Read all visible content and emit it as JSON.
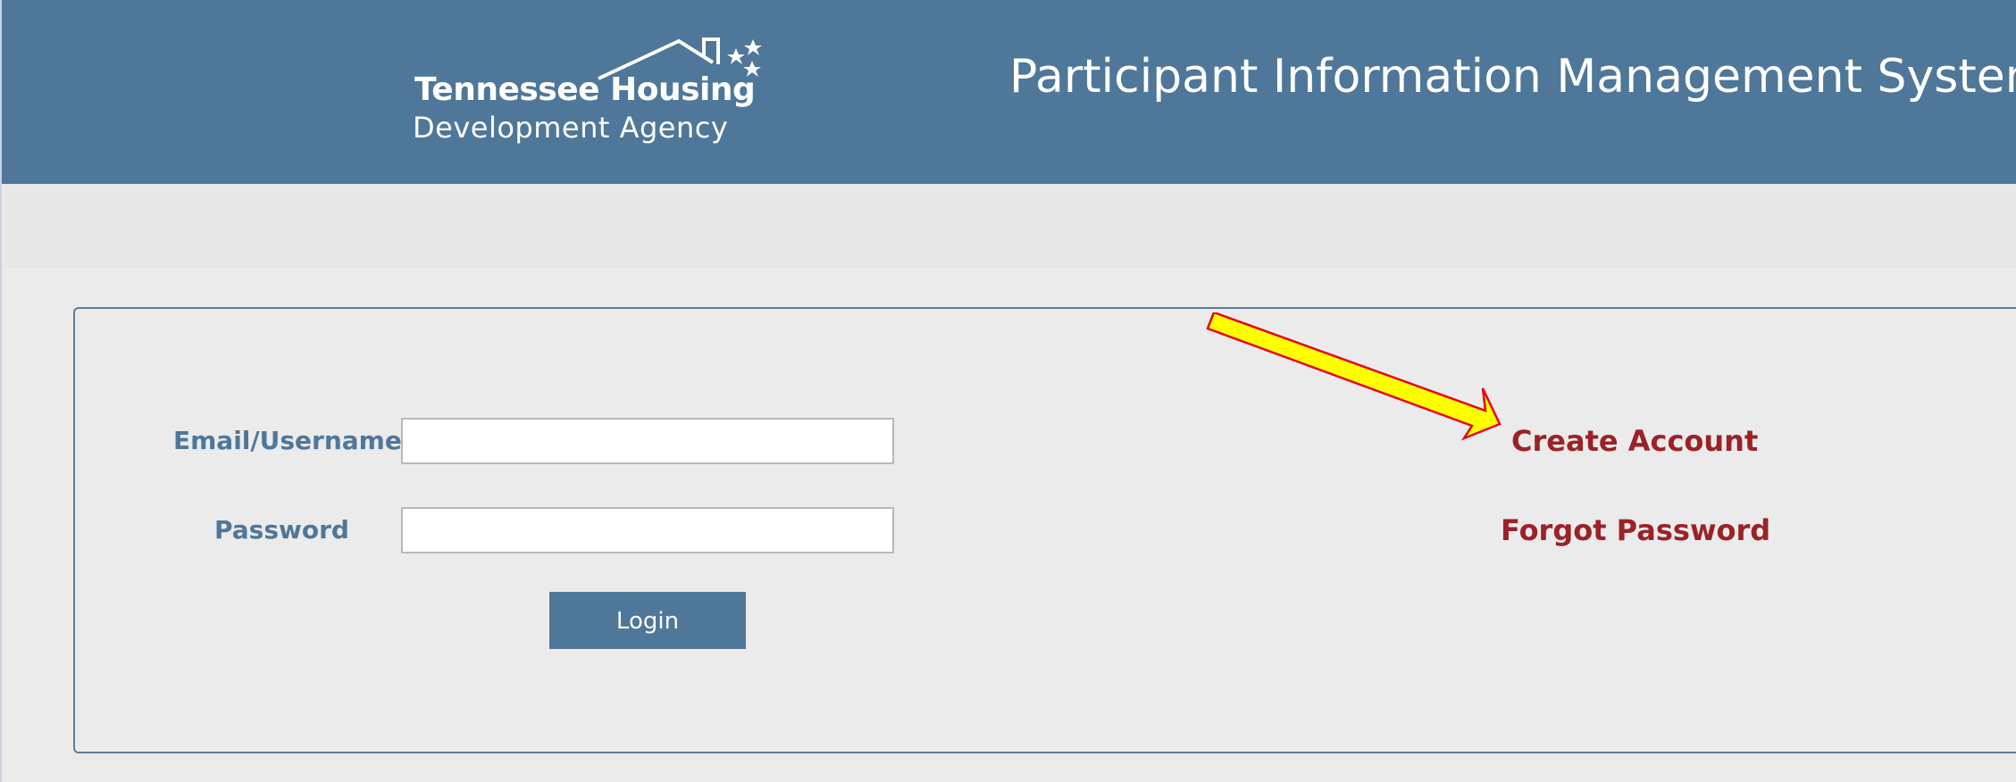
{
  "header": {
    "logo": {
      "line1": "Tennessee Housing",
      "line2": "Development Agency",
      "icon_name": "house-stars-logo-icon"
    },
    "app_title": "Participant Information Management System",
    "background_color": "#4f7799"
  },
  "login_form": {
    "email_label": "Email/Username",
    "email_value": "",
    "email_placeholder": "",
    "password_label": "Password",
    "password_value": "",
    "password_placeholder": "",
    "login_button_label": "Login"
  },
  "links": {
    "create_account": "Create Account",
    "forgot_password": "Forgot Password",
    "color": "#9b2227"
  },
  "annotation": {
    "icon_name": "yellow-arrow-icon",
    "fill_color": "#ffff00",
    "stroke_color": "#e8001c"
  }
}
